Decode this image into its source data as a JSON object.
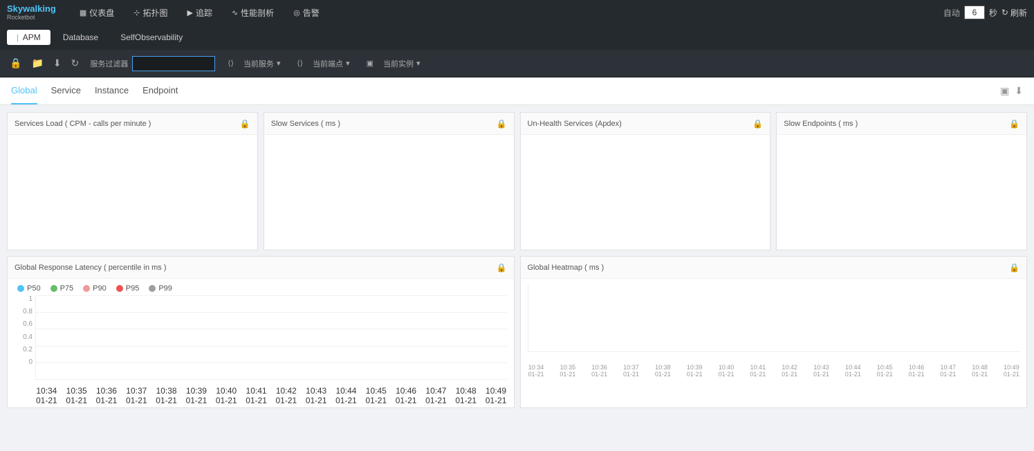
{
  "logo": {
    "name": "Skywalking",
    "sub": "Rocketbot"
  },
  "nav": {
    "items": [
      {
        "id": "dashboard",
        "label": "仪表盘",
        "icon": "⊞"
      },
      {
        "id": "topology",
        "label": "拓扑图",
        "icon": "⊹"
      },
      {
        "id": "trace",
        "label": "追踪",
        "icon": "⊳"
      },
      {
        "id": "performance",
        "label": "性能剖析",
        "icon": "∿"
      },
      {
        "id": "alert",
        "label": "告警",
        "icon": "⊙"
      }
    ]
  },
  "topRight": {
    "autoLabel": "自动",
    "seconds": "6",
    "secLabel": "秒",
    "refreshLabel": "刷新"
  },
  "tabs": {
    "items": [
      {
        "id": "apm",
        "label": "APM",
        "active": true
      },
      {
        "id": "database",
        "label": "Database",
        "active": false
      },
      {
        "id": "selfobs",
        "label": "SelfObservability",
        "active": false
      }
    ]
  },
  "toolbar": {
    "filterLabel": "服务过滤器",
    "filterPlaceholder": "",
    "serviceLabel": "当前服务",
    "endpointLabel": "当前端点",
    "instanceLabel": "当前实例",
    "icons": [
      "lock",
      "folder",
      "download",
      "refresh"
    ]
  },
  "contentTabs": {
    "items": [
      {
        "id": "global",
        "label": "Global",
        "active": true
      },
      {
        "id": "service",
        "label": "Service",
        "active": false
      },
      {
        "id": "instance",
        "label": "Instance",
        "active": false
      },
      {
        "id": "endpoint",
        "label": "Endpoint",
        "active": false
      }
    ]
  },
  "panels": {
    "topRow": [
      {
        "id": "services-load",
        "title": "Services Load ( CPM - calls per minute )"
      },
      {
        "id": "slow-services",
        "title": "Slow Services ( ms )"
      },
      {
        "id": "unhealthy-services",
        "title": "Un-Health Services (Apdex)"
      },
      {
        "id": "slow-endpoints",
        "title": "Slow Endpoints ( ms )"
      }
    ]
  },
  "chart": {
    "title": "Global Response Latency ( percentile in ms )",
    "heatmapTitle": "Global Heatmap ( ms )",
    "legend": [
      {
        "id": "p50",
        "label": "P50",
        "color": "#4fc3f7"
      },
      {
        "id": "p75",
        "label": "P75",
        "color": "#66bb6a"
      },
      {
        "id": "p90",
        "label": "P90",
        "color": "#ef9a9a"
      },
      {
        "id": "p95",
        "label": "P95",
        "color": "#ef5350"
      },
      {
        "id": "p99",
        "label": "P99",
        "color": "#9e9e9e"
      }
    ],
    "yAxis": [
      "1",
      "0.8",
      "0.6",
      "0.4",
      "0.2",
      "0"
    ],
    "xLabels": [
      {
        "time": "10:34",
        "date": "01-21"
      },
      {
        "time": "10:35",
        "date": "01-21"
      },
      {
        "time": "10:36",
        "date": "01-21"
      },
      {
        "time": "10:37",
        "date": "01-21"
      },
      {
        "time": "10:38",
        "date": "01-21"
      },
      {
        "time": "10:39",
        "date": "01-21"
      },
      {
        "time": "10:40",
        "date": "01-21"
      },
      {
        "time": "10:41",
        "date": "01-21"
      },
      {
        "time": "10:42",
        "date": "01-21"
      },
      {
        "time": "10:43",
        "date": "01-21"
      },
      {
        "time": "10:44",
        "date": "01-21"
      },
      {
        "time": "10:45",
        "date": "01-21"
      },
      {
        "time": "10:46",
        "date": "01-21"
      },
      {
        "time": "10:47",
        "date": "01-21"
      },
      {
        "time": "10:48",
        "date": "01-21"
      },
      {
        "time": "10:49",
        "date": "01-21"
      }
    ],
    "heatmapXLabels": [
      {
        "time": "10:34",
        "date": "01-21"
      },
      {
        "time": "10:35",
        "date": "01-21"
      },
      {
        "time": "10:36",
        "date": "01-21"
      },
      {
        "time": "10:37",
        "date": "01-21"
      },
      {
        "time": "10:38",
        "date": "01-21"
      },
      {
        "time": "10:39",
        "date": "01-21"
      },
      {
        "time": "10:40",
        "date": "01-21"
      },
      {
        "time": "10:41",
        "date": "01-21"
      },
      {
        "time": "10:42",
        "date": "01-21"
      },
      {
        "time": "10:43",
        "date": "01-21"
      },
      {
        "time": "10:44",
        "date": "01-21"
      },
      {
        "time": "10:45",
        "date": "01-21"
      },
      {
        "time": "10:46",
        "date": "01-21"
      },
      {
        "time": "10:47",
        "date": "01-21"
      },
      {
        "time": "10:48",
        "date": "01-21"
      },
      {
        "time": "10:49",
        "date": "01-21"
      }
    ]
  }
}
